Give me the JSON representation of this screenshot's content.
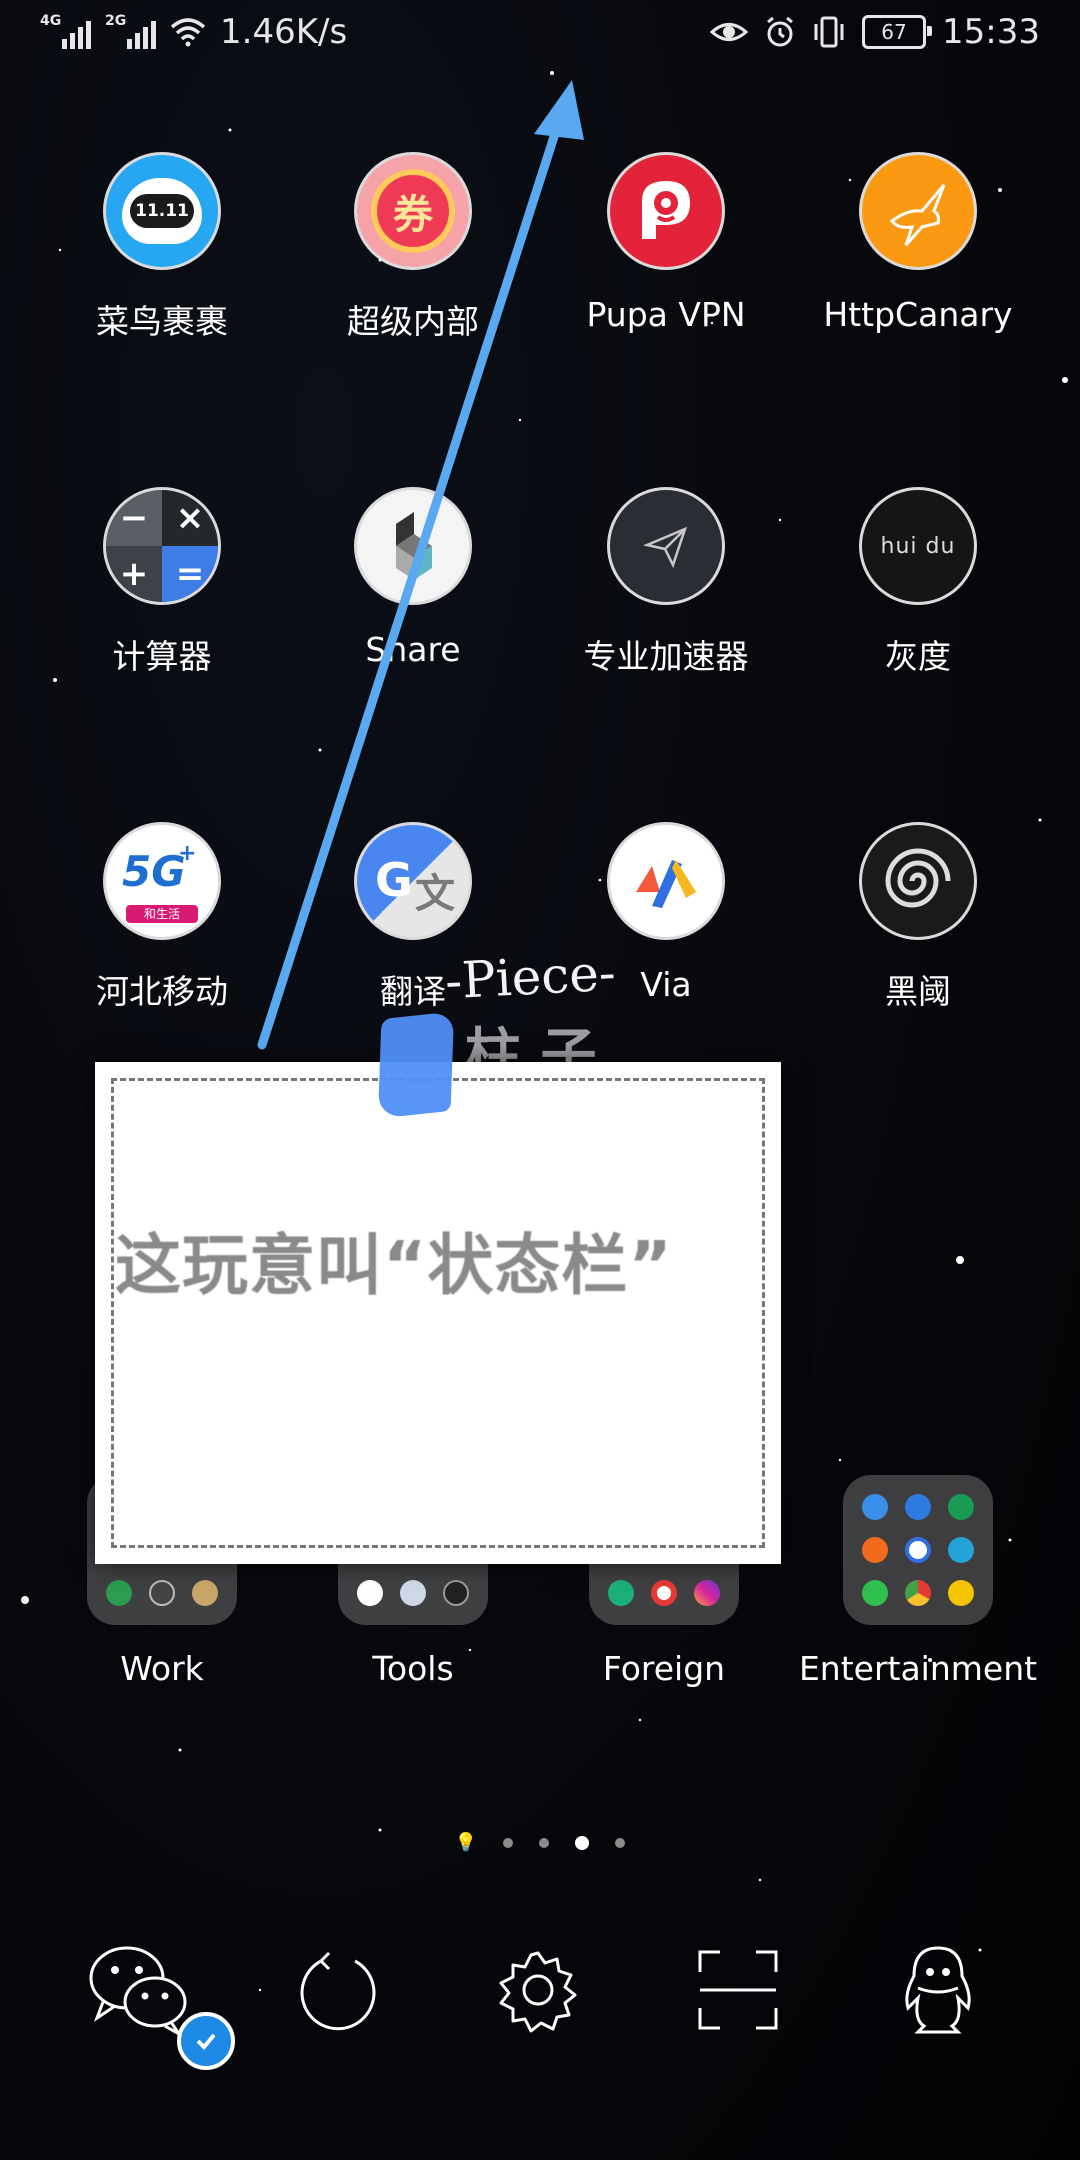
{
  "status_bar": {
    "net1": "4G",
    "net2": "2G",
    "speed": "1.46K/s",
    "battery": "67",
    "time": "15:33"
  },
  "apps": [
    {
      "label": "菜鸟裹裹",
      "icon": "cainiao-icon"
    },
    {
      "label": "超级内部",
      "icon": "coupon-icon"
    },
    {
      "label": "Pupa VPN",
      "icon": "pupa-vpn-icon"
    },
    {
      "label": "HttpCanary",
      "icon": "httpcanary-icon"
    },
    {
      "label": "计算器",
      "icon": "calculator-icon"
    },
    {
      "label": "Share",
      "icon": "share-icon"
    },
    {
      "label": "专业加速器",
      "icon": "accelerator-icon"
    },
    {
      "label": "灰度",
      "icon": "huidu-icon"
    },
    {
      "label": "河北移动",
      "icon": "hebei-mobile-icon"
    },
    {
      "label": "翻译",
      "icon": "translate-icon"
    },
    {
      "label": "Via",
      "icon": "via-browser-icon"
    },
    {
      "label": "黑阈",
      "icon": "heiyu-icon"
    }
  ],
  "icon_text": {
    "cainiao": "11.11",
    "coupon": "券",
    "huidu": "hui du",
    "calc_ops": [
      "−",
      "×",
      "+",
      "="
    ],
    "hebei": "5G",
    "hebei_sub": "和生活",
    "translate_g": "G",
    "translate_wen": "文"
  },
  "overlay": {
    "piece": "-Piece-",
    "piece_sub": "柱 子",
    "card_text": "这玩意叫“状态栏”"
  },
  "folders": [
    {
      "label": "Work"
    },
    {
      "label": "Tools"
    },
    {
      "label": "Foreign"
    },
    {
      "label": "Entertainment"
    }
  ],
  "pager": {
    "pages": 5,
    "active_index": 3
  },
  "dock": [
    "wechat-icon",
    "refresh-icon",
    "settings-icon",
    "scan-icon",
    "qq-icon"
  ],
  "colors": {
    "arrow": "#5aa8f0",
    "accent_blue": "#1e88e5"
  }
}
